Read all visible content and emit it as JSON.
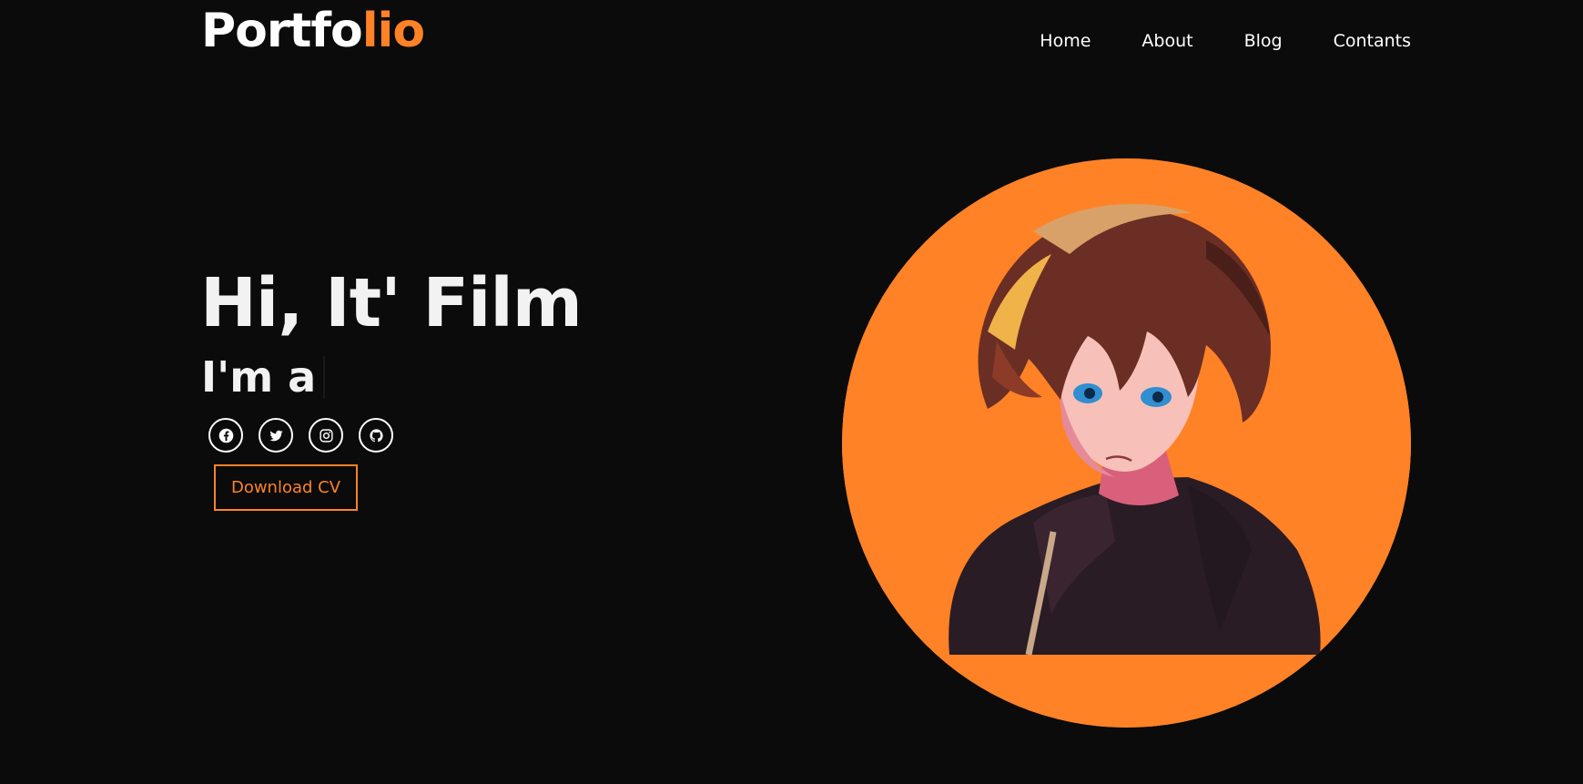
{
  "header": {
    "logo_main": "Portfo",
    "logo_accent": "lio"
  },
  "nav": {
    "items": [
      {
        "label": "Home"
      },
      {
        "label": "About"
      },
      {
        "label": "Blog"
      },
      {
        "label": "Contants"
      }
    ]
  },
  "hero": {
    "title": "Hi, It' Film",
    "subtitle": "I'm a",
    "cv_button": "Download CV"
  },
  "socials": [
    {
      "icon": "facebook-icon"
    },
    {
      "icon": "twitter-icon"
    },
    {
      "icon": "instagram-icon"
    },
    {
      "icon": "github-icon"
    }
  ],
  "colors": {
    "background": "#0b0b0b",
    "accent": "#ff8226",
    "text": "#ffffff"
  }
}
